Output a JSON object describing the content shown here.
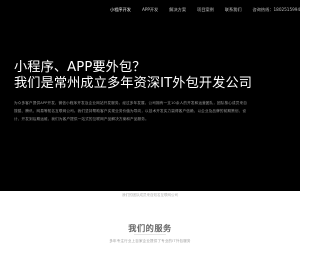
{
  "nav": {
    "items": [
      {
        "label": "小程序开发"
      },
      {
        "label": "APP开发"
      },
      {
        "label": "解决方案"
      },
      {
        "label": "项目案例"
      },
      {
        "label": "联系我们"
      }
    ],
    "phone": "咨询热线：18025159940"
  },
  "hero": {
    "headline_line1": "小程序、APP要外包？",
    "headline_line2": "我们是常州成立多年资深IT外包开发公司",
    "intro": "为众多客户提供APP开发、微信小程序开发及企业网站开发服务。经过多年发展，公司拥有一支10余人的开发和运营团队，团队核心成员来自搜狐、腾讯、网易等知名互联网公司。我们坚持帮助客户实现业务价值为导向，以技术开发实力赢得客户信赖，以企业及品牌的前期策划、设计、开发到后期运维，我们为客户提供一站式的互联网产品解决方案和产品服务。"
  },
  "note": {
    "text": "我们的团队成员来自知名互联网公司"
  },
  "services": {
    "title": "我们的服务",
    "subtitle": "多年专注行业上百家企业提供了专业的IT外包服务"
  }
}
